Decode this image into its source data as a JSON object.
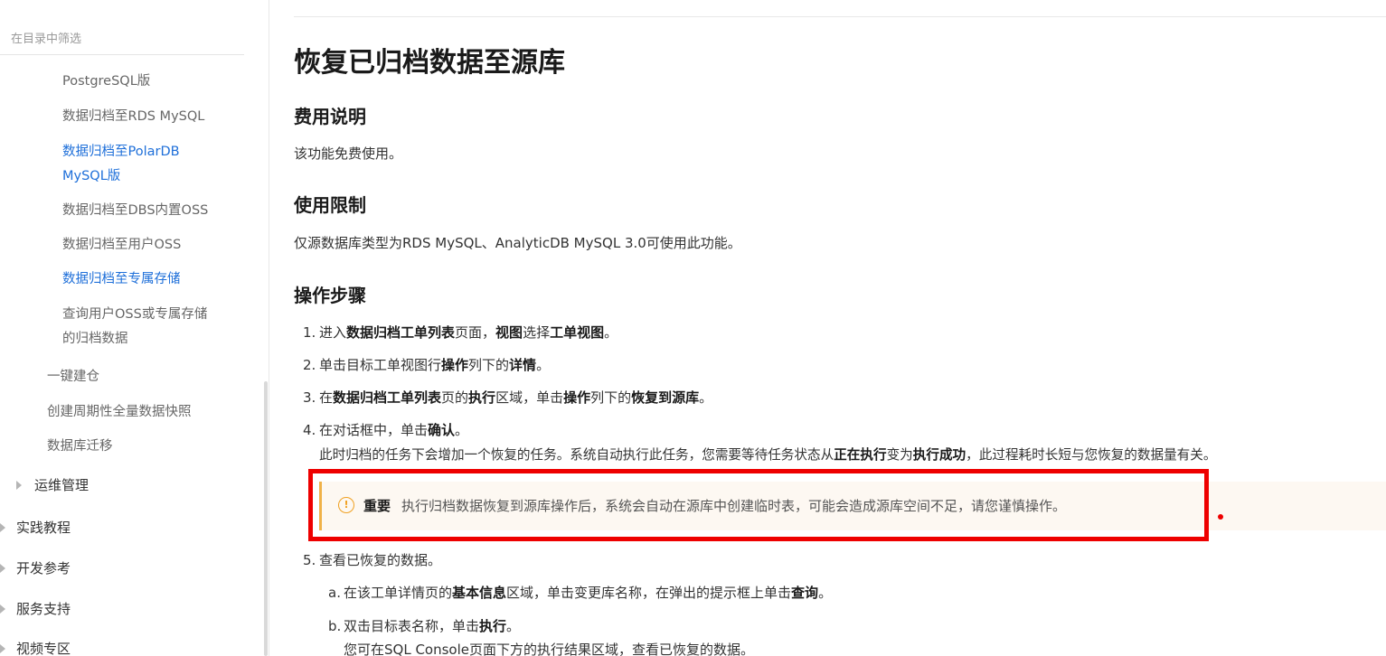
{
  "sidebar": {
    "filter_placeholder": "在目录中筛选",
    "items": [
      {
        "label": "PostgreSQL版"
      },
      {
        "label": "数据归档至RDS MySQL"
      },
      {
        "label_line1": "数据归档至PolarDB",
        "label_line2": "MySQL版"
      },
      {
        "label": "数据归档至DBS内置OSS"
      },
      {
        "label": "数据归档至用户OSS"
      },
      {
        "label": "数据归档至专属存储"
      },
      {
        "label_line1": "查询用户OSS或专属存储",
        "label_line2": "的归档数据"
      },
      {
        "label": "一键建仓"
      },
      {
        "label": "创建周期性全量数据快照"
      },
      {
        "label": "数据库迁移"
      },
      {
        "label": "运维管理"
      },
      {
        "label": "实践教程"
      },
      {
        "label": "开发参考"
      },
      {
        "label": "服务支持"
      },
      {
        "label": "视频专区"
      }
    ],
    "active_color": "#1e6fd9"
  },
  "article": {
    "title": "恢复已归档数据至源库",
    "fee": {
      "heading": "费用说明",
      "text": "该功能免费使用。"
    },
    "limits": {
      "heading": "使用限制",
      "text": "仅源数据库类型为RDS MySQL、AnalyticDB MySQL 3.0可使用此功能。"
    },
    "steps_heading": "操作步骤",
    "steps": [
      {
        "num": "1.",
        "t1": "进入",
        "b1": "数据归档工单列表",
        "t2": "页面，",
        "b2": "视图",
        "t3": "选择",
        "b3": "工单视图",
        "t4": "。"
      },
      {
        "num": "2.",
        "t1": "单击目标工单视图行",
        "b1": "操作",
        "t2": "列下的",
        "b2": "详情",
        "t3": "。"
      },
      {
        "num": "3.",
        "t1": "在",
        "b1": "数据归档工单列表",
        "t2": "页的",
        "b2": "执行",
        "t3": "区域，单击",
        "b3": "操作",
        "t4": "列下的",
        "b4": "恢复到源库",
        "t5": "。"
      },
      {
        "num": "4.",
        "t1": "在对话框中，单击",
        "b1": "确认",
        "t2": "。",
        "sub_t1": "此时归档的任务下会增加一个恢复的任务。系统自动执行此任务，您需要等待任务状态从",
        "sub_b1": "正在执行",
        "sub_t2": "变为",
        "sub_b2": "执行成功",
        "sub_t3": "，此过程耗时长短与您恢复的数据量有关。"
      },
      {
        "num": "5.",
        "t1": "查看已恢复的数据。"
      }
    ],
    "substeps": [
      {
        "num": "a.",
        "t1": "在该工单详情页的",
        "b1": "基本信息",
        "t2": "区域，单击变更库名称，在弹出的提示框上单击",
        "b2": "查询",
        "t3": "。"
      },
      {
        "num": "b.",
        "t1": "双击目标表名称，单击",
        "b1": "执行",
        "t2": "。",
        "sub": "您可在SQL Console页面下方的执行结果区域，查看已恢复的数据。"
      }
    ],
    "callout": {
      "label": "重要",
      "text": "执行归档数据恢复到源库操作后，系统会自动在源库中创建临时表，可能会造成源库空间不足，请您谨慎操作。",
      "icon": "warning-icon",
      "accent": "#f0b249"
    },
    "highlight_color": "#ee0000"
  }
}
